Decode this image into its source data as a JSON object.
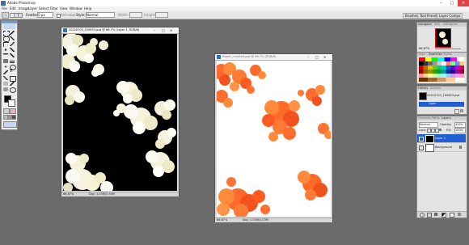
{
  "app": {
    "title": "Adobe Photoshop"
  },
  "menu": [
    "File",
    "Edit",
    "Image",
    "Layer",
    "Select",
    "Filter",
    "View",
    "Window",
    "Help"
  ],
  "options": {
    "feather_label": "Feather:",
    "feather_value": "0 px",
    "antialias_label": "Anti-alias",
    "style_label": "Style:",
    "style_value": "Normal",
    "width_label": "Width:",
    "height_label": "Height:",
    "brushes_tab": "Brushes",
    "tool_presets_tab": "Tool Presets",
    "layer_comps_tab": "Layer Comps"
  },
  "doc1": {
    "title": "20220703_105653.psd @ 66.7% (Layer 1, RGB/8)",
    "zoom": "66.67%",
    "status": "Doc: 1.03M/3.94M"
  },
  "doc2": {
    "title": "flower_inverted.psd @ 66.7% (RGB/8)",
    "zoom": "66.67%",
    "status": "Doc: 1.03M/1.03M"
  },
  "navigator": {
    "tabs": [
      "Navigator",
      "Info",
      "Histogram"
    ],
    "zoom": "66.67%"
  },
  "color": {
    "tabs": [
      "Color",
      "Swatches",
      "Styles"
    ]
  },
  "history": {
    "tabs": [
      "History",
      "Actions"
    ],
    "snapshot": "20220703_105653.psd",
    "items": [
      "Open"
    ]
  },
  "layers": {
    "tabs": [
      "Channels",
      "Paths",
      "Layers"
    ],
    "blend_mode": "Normal",
    "opacity_label": "Opacity:",
    "opacity_value": "100%",
    "lock_label": "Lock:",
    "fill_label": "Fill:",
    "fill_value": "100%",
    "items": [
      "Layer 1",
      "Background"
    ]
  },
  "colors": {
    "accent": "#1f5fd1",
    "flower_white": "#f4f1d9",
    "flower_orange": "#ff6a2a"
  }
}
